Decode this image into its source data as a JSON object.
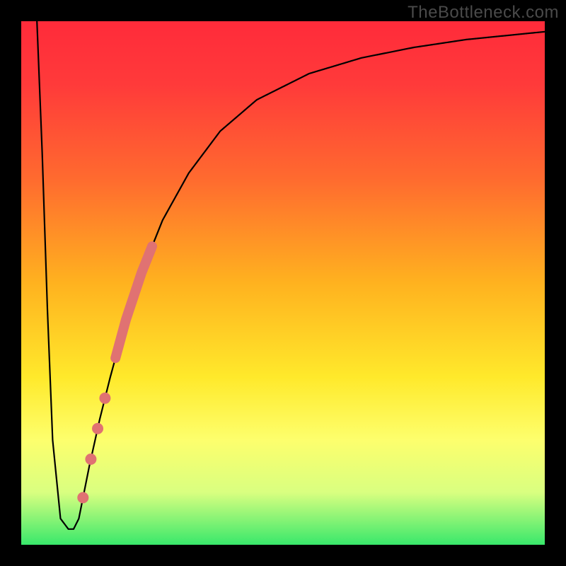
{
  "watermark": "TheBottleneck.com",
  "chart_data": {
    "type": "line",
    "title": "",
    "xlabel": "",
    "ylabel": "",
    "xlim": [
      0,
      100
    ],
    "ylim": [
      0,
      100
    ],
    "series": [
      {
        "name": "curve",
        "x": [
          3,
          4,
          5,
          6,
          7.5,
          9,
          10,
          11,
          12,
          13,
          15,
          17,
          20,
          23,
          27,
          32,
          38,
          45,
          55,
          65,
          75,
          85,
          95,
          100
        ],
        "values": [
          100,
          75,
          45,
          20,
          5,
          3,
          3,
          5,
          10,
          15,
          24,
          32,
          43,
          52,
          62,
          71,
          79,
          85,
          90,
          93,
          95,
          96.5,
          97.5,
          98
        ]
      }
    ],
    "markers": [
      {
        "series": "curve",
        "x_start": 18,
        "x_end": 25,
        "style": "thick-line"
      },
      {
        "series": "curve",
        "x": 16.0,
        "style": "dot"
      },
      {
        "series": "curve",
        "x": 14.6,
        "style": "dot"
      },
      {
        "series": "curve",
        "x": 13.3,
        "style": "dot"
      },
      {
        "series": "curve",
        "x": 11.8,
        "style": "dot"
      }
    ],
    "marker_color": "#e07272",
    "curve_color": "#000000"
  }
}
